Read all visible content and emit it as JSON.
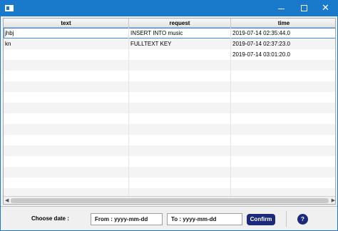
{
  "titlebar": {
    "icon": "app-window-icon",
    "minimize_glyph": "",
    "close_glyph": "✕"
  },
  "table": {
    "columns": [
      "text",
      "request",
      "time"
    ],
    "rows": [
      [
        "jhbj",
        "INSERT INTO music",
        "2019-07-14 02:35:44.0"
      ],
      [
        "kn",
        "FULLTEXT KEY",
        "2019-07-14 02:37:23.0"
      ],
      [
        "",
        "",
        "2019-07-14 03:01:20.0"
      ]
    ],
    "empty_rows": 13
  },
  "footer": {
    "choose_label": "Choose date :",
    "from_value": "From : yyyy-mm-dd",
    "to_value": "To : yyyy-mm-dd",
    "confirm_label": "Confirm",
    "help_label": "?"
  },
  "colors": {
    "titlebar": "#1979ca",
    "button": "#1c2a7a"
  }
}
